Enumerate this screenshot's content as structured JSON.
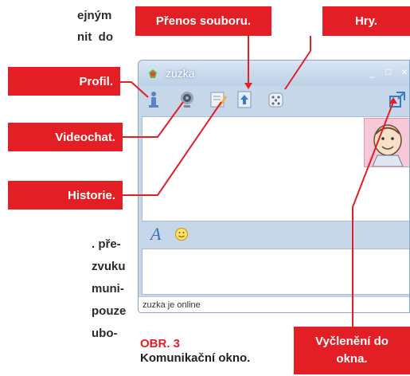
{
  "page_text": {
    "top_lines": [
      "ejným",
      "nit  do"
    ],
    "bottom_lines": [
      ". pře-",
      "zvuku",
      "muni-",
      "pouze",
      "ubo-"
    ]
  },
  "callouts": {
    "file_transfer": "Přenos souboru.",
    "games": "Hry.",
    "profile": "Profil.",
    "videochat": "Videochat.",
    "history": "Historie.",
    "detach_line1": "Vyčlenění do",
    "detach_line2": "okna."
  },
  "window": {
    "title": "zuzka",
    "status": "zuzka je online",
    "minimize_glyph": "_",
    "maximize_glyph": "□",
    "close_glyph": "×",
    "font_glyph": "A"
  },
  "caption": {
    "number": "OBR. 3",
    "text": "Komunikační okno."
  },
  "colors": {
    "accent_red": "#e31e24",
    "window_blue": "#c7d7ea"
  },
  "icons": [
    "profile-icon",
    "webcam-icon",
    "history-icon",
    "file-transfer-icon",
    "games-icon",
    "detach-window-icon",
    "font-icon",
    "smiley-icon"
  ]
}
